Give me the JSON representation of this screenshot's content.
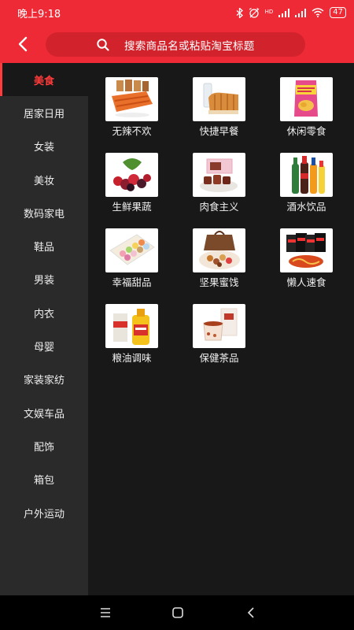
{
  "status_bar": {
    "time": "晚上9:18",
    "network": "HD",
    "battery": "47",
    "icons": [
      "bluetooth-icon",
      "alarm-icon",
      "signal-icon",
      "signal-icon",
      "wifi-icon",
      "battery-icon"
    ]
  },
  "header": {
    "back_icon": "back-arrow-icon",
    "search_icon": "search-icon",
    "search_placeholder": "搜索商品名或粘贴淘宝标题"
  },
  "sidebar": {
    "active_index": 0,
    "items": [
      {
        "label": "美食"
      },
      {
        "label": "居家日用"
      },
      {
        "label": "女装"
      },
      {
        "label": "美妆"
      },
      {
        "label": "数码家电"
      },
      {
        "label": "鞋品"
      },
      {
        "label": "男装"
      },
      {
        "label": "内衣"
      },
      {
        "label": "母婴"
      },
      {
        "label": "家装家纺"
      },
      {
        "label": "文娱车品"
      },
      {
        "label": "配饰"
      },
      {
        "label": "箱包"
      },
      {
        "label": "户外运动"
      }
    ]
  },
  "categories": [
    {
      "label": "无辣不欢",
      "icon": "spicy-snack-icon"
    },
    {
      "label": "快捷早餐",
      "icon": "bread-milk-icon"
    },
    {
      "label": "休闲零食",
      "icon": "chips-bag-icon"
    },
    {
      "label": "生鲜果蔬",
      "icon": "berries-icon"
    },
    {
      "label": "肉食主义",
      "icon": "meat-dish-icon"
    },
    {
      "label": "酒水饮品",
      "icon": "bottles-icon"
    },
    {
      "label": "幸福甜品",
      "icon": "macarons-icon"
    },
    {
      "label": "坚果蜜饯",
      "icon": "nuts-box-icon"
    },
    {
      "label": "懒人速食",
      "icon": "instant-noodles-icon"
    },
    {
      "label": "粮油调味",
      "icon": "oil-bottle-icon"
    },
    {
      "label": "保健茶品",
      "icon": "tea-cup-icon"
    }
  ],
  "colors": {
    "header_red": "#ee2a36",
    "search_bg": "#d2232d",
    "sidebar_bg": "#2a2a2a",
    "content_bg": "#181818",
    "active_red": "#ff3b3b"
  },
  "nav_bar": {
    "icons": [
      "menu-icon",
      "home-icon",
      "back-icon"
    ]
  }
}
